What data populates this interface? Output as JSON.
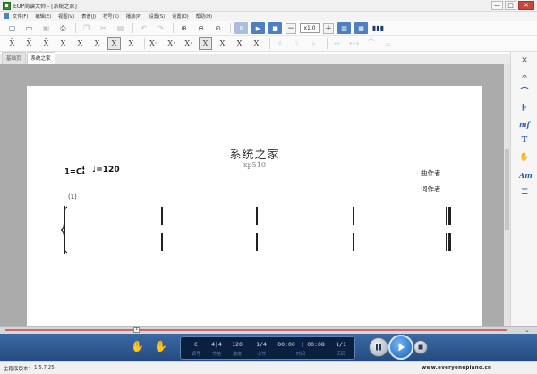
{
  "window": {
    "title": "EOP简谱大师 - [系统之家]",
    "minimize": "—",
    "maximize": "□",
    "close": "✕"
  },
  "menu": [
    "文件(F)",
    "编辑(E)",
    "视图(V)",
    "表谱(J)",
    "符号(K)",
    "播放(P)",
    "设置(S)",
    "设置(O)",
    "帮助(H)"
  ],
  "toolbar": {
    "speed": "x1.0",
    "minus": "−",
    "plus": "+"
  },
  "note_buttons": [
    "X̄",
    "X̄",
    "X̄",
    "X",
    "X",
    "X",
    "X",
    "X",
    "X··",
    "X·",
    "X·",
    "X",
    "X",
    "X",
    "X"
  ],
  "tabs": [
    "基础页",
    "系统之家"
  ],
  "score": {
    "title": "系统之家",
    "subtitle": "xp510",
    "key": "1=C",
    "time_sig_top": "4",
    "time_sig_bottom": "4",
    "tempo_note": "♩",
    "tempo_value": "=120",
    "composer": "曲作者",
    "lyricist": "词作者",
    "measure_number": "(1)"
  },
  "timeline": {
    "marker": "1"
  },
  "player": {
    "key": "C",
    "time_sig": "4|4",
    "tempo": "120",
    "bar": "1/4",
    "time_start": "00:00",
    "time_end": "00:08",
    "page": "1/1",
    "labels": [
      "调号",
      "节拍",
      "速度",
      "小节",
      "时间",
      "页码"
    ]
  },
  "status": {
    "label": "主程序版本：",
    "version": "1.5.7.25",
    "url": "www.everyonepiano.cn"
  },
  "colors": {
    "accent": "#2d5fa3",
    "player_bg": "#2e5a92",
    "timeline_track": "#c86a6a"
  }
}
